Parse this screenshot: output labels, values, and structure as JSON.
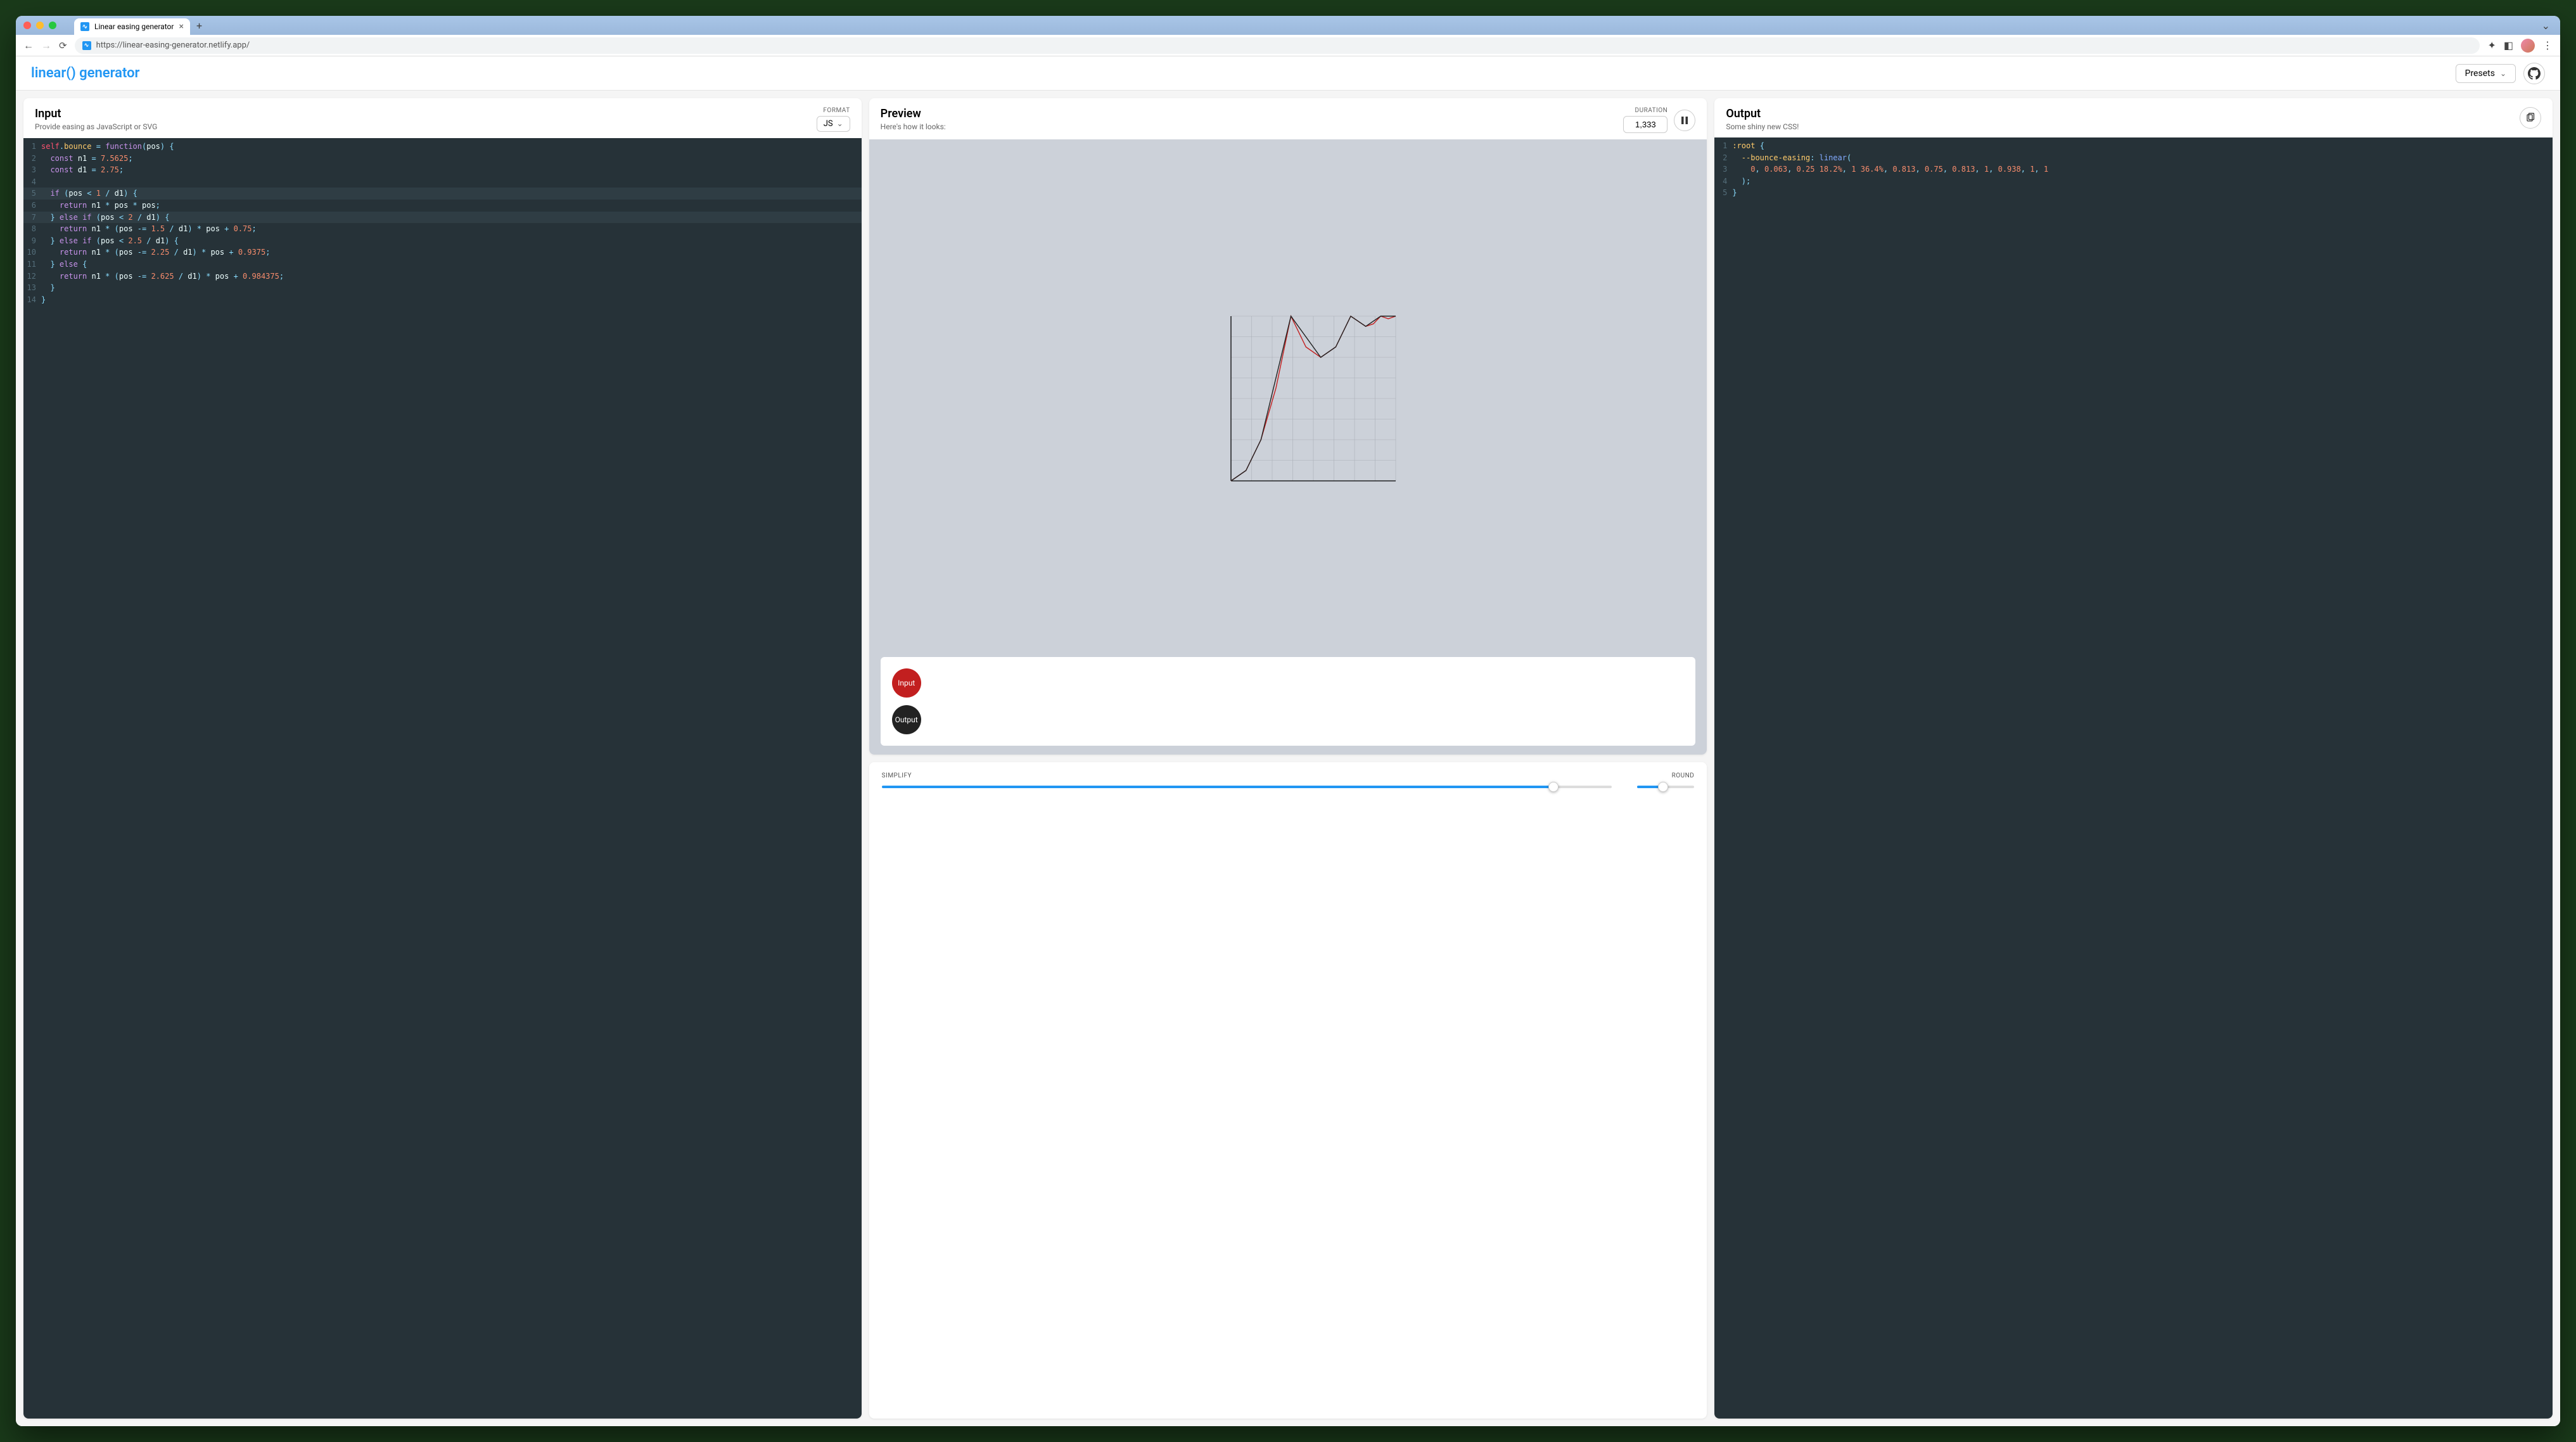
{
  "browser": {
    "tab_title": "Linear easing generator",
    "url": "https://linear-easing-generator.netlify.app/"
  },
  "header": {
    "app_title": "linear() generator",
    "presets_label": "Presets"
  },
  "input_panel": {
    "title": "Input",
    "subtitle": "Provide easing as JavaScript or SVG",
    "format_label": "FORMAT",
    "format_value": "JS",
    "code_lines": [
      {
        "n": 1,
        "hl": false,
        "tokens": [
          [
            "self",
            "self"
          ],
          [
            "op",
            "."
          ],
          [
            "prop",
            "bounce"
          ],
          [
            "var",
            " "
          ],
          [
            "op",
            "="
          ],
          [
            "var",
            " "
          ],
          [
            "kw",
            "function"
          ],
          [
            "pn",
            "("
          ],
          [
            "var",
            "pos"
          ],
          [
            "pn",
            ")"
          ],
          [
            "var",
            " "
          ],
          [
            "pn",
            "{"
          ]
        ]
      },
      {
        "n": 2,
        "hl": false,
        "tokens": [
          [
            "var",
            "  "
          ],
          [
            "kw",
            "const"
          ],
          [
            "var",
            " n1 "
          ],
          [
            "op",
            "="
          ],
          [
            "var",
            " "
          ],
          [
            "num",
            "7.5625"
          ],
          [
            "pn",
            ";"
          ]
        ]
      },
      {
        "n": 3,
        "hl": false,
        "tokens": [
          [
            "var",
            "  "
          ],
          [
            "kw",
            "const"
          ],
          [
            "var",
            " d1 "
          ],
          [
            "op",
            "="
          ],
          [
            "var",
            " "
          ],
          [
            "num",
            "2.75"
          ],
          [
            "pn",
            ";"
          ]
        ]
      },
      {
        "n": 4,
        "hl": false,
        "tokens": [
          [
            "var",
            ""
          ]
        ]
      },
      {
        "n": 5,
        "hl": true,
        "tokens": [
          [
            "var",
            "  "
          ],
          [
            "kw",
            "if"
          ],
          [
            "var",
            " "
          ],
          [
            "pn",
            "("
          ],
          [
            "var",
            "pos "
          ],
          [
            "op",
            "<"
          ],
          [
            "var",
            " "
          ],
          [
            "num",
            "1"
          ],
          [
            "var",
            " "
          ],
          [
            "op",
            "/"
          ],
          [
            "var",
            " d1"
          ],
          [
            "pn",
            ")"
          ],
          [
            "var",
            " "
          ],
          [
            "pn",
            "{"
          ]
        ]
      },
      {
        "n": 6,
        "hl": false,
        "tokens": [
          [
            "var",
            "    "
          ],
          [
            "kw",
            "return"
          ],
          [
            "var",
            " n1 "
          ],
          [
            "op",
            "*"
          ],
          [
            "var",
            " pos "
          ],
          [
            "op",
            "*"
          ],
          [
            "var",
            " pos"
          ],
          [
            "pn",
            ";"
          ]
        ]
      },
      {
        "n": 7,
        "hl": true,
        "tokens": [
          [
            "var",
            "  "
          ],
          [
            "pn",
            "}"
          ],
          [
            "var",
            " "
          ],
          [
            "kw",
            "else"
          ],
          [
            "var",
            " "
          ],
          [
            "kw",
            "if"
          ],
          [
            "var",
            " "
          ],
          [
            "pn",
            "("
          ],
          [
            "var",
            "pos "
          ],
          [
            "op",
            "<"
          ],
          [
            "var",
            " "
          ],
          [
            "num",
            "2"
          ],
          [
            "var",
            " "
          ],
          [
            "op",
            "/"
          ],
          [
            "var",
            " d1"
          ],
          [
            "pn",
            ")"
          ],
          [
            "var",
            " "
          ],
          [
            "pn",
            "{"
          ]
        ]
      },
      {
        "n": 8,
        "hl": false,
        "tokens": [
          [
            "var",
            "    "
          ],
          [
            "kw",
            "return"
          ],
          [
            "var",
            " n1 "
          ],
          [
            "op",
            "*"
          ],
          [
            "var",
            " "
          ],
          [
            "pn",
            "("
          ],
          [
            "var",
            "pos "
          ],
          [
            "op",
            "-="
          ],
          [
            "var",
            " "
          ],
          [
            "num",
            "1.5"
          ],
          [
            "var",
            " "
          ],
          [
            "op",
            "/"
          ],
          [
            "var",
            " d1"
          ],
          [
            "pn",
            ")"
          ],
          [
            "var",
            " "
          ],
          [
            "op",
            "*"
          ],
          [
            "var",
            " pos "
          ],
          [
            "op",
            "+"
          ],
          [
            "var",
            " "
          ],
          [
            "num",
            "0.75"
          ],
          [
            "pn",
            ";"
          ]
        ]
      },
      {
        "n": 9,
        "hl": false,
        "tokens": [
          [
            "var",
            "  "
          ],
          [
            "pn",
            "}"
          ],
          [
            "var",
            " "
          ],
          [
            "kw",
            "else"
          ],
          [
            "var",
            " "
          ],
          [
            "kw",
            "if"
          ],
          [
            "var",
            " "
          ],
          [
            "pn",
            "("
          ],
          [
            "var",
            "pos "
          ],
          [
            "op",
            "<"
          ],
          [
            "var",
            " "
          ],
          [
            "num",
            "2.5"
          ],
          [
            "var",
            " "
          ],
          [
            "op",
            "/"
          ],
          [
            "var",
            " d1"
          ],
          [
            "pn",
            ")"
          ],
          [
            "var",
            " "
          ],
          [
            "pn",
            "{"
          ]
        ]
      },
      {
        "n": 10,
        "hl": false,
        "tokens": [
          [
            "var",
            "    "
          ],
          [
            "kw",
            "return"
          ],
          [
            "var",
            " n1 "
          ],
          [
            "op",
            "*"
          ],
          [
            "var",
            " "
          ],
          [
            "pn",
            "("
          ],
          [
            "var",
            "pos "
          ],
          [
            "op",
            "-="
          ],
          [
            "var",
            " "
          ],
          [
            "num",
            "2.25"
          ],
          [
            "var",
            " "
          ],
          [
            "op",
            "/"
          ],
          [
            "var",
            " d1"
          ],
          [
            "pn",
            ")"
          ],
          [
            "var",
            " "
          ],
          [
            "op",
            "*"
          ],
          [
            "var",
            " pos "
          ],
          [
            "op",
            "+"
          ],
          [
            "var",
            " "
          ],
          [
            "num",
            "0.9375"
          ],
          [
            "pn",
            ";"
          ]
        ]
      },
      {
        "n": 11,
        "hl": false,
        "tokens": [
          [
            "var",
            "  "
          ],
          [
            "pn",
            "}"
          ],
          [
            "var",
            " "
          ],
          [
            "kw",
            "else"
          ],
          [
            "var",
            " "
          ],
          [
            "pn",
            "{"
          ]
        ]
      },
      {
        "n": 12,
        "hl": false,
        "tokens": [
          [
            "var",
            "    "
          ],
          [
            "kw",
            "return"
          ],
          [
            "var",
            " n1 "
          ],
          [
            "op",
            "*"
          ],
          [
            "var",
            " "
          ],
          [
            "pn",
            "("
          ],
          [
            "var",
            "pos "
          ],
          [
            "op",
            "-="
          ],
          [
            "var",
            " "
          ],
          [
            "num",
            "2.625"
          ],
          [
            "var",
            " "
          ],
          [
            "op",
            "/"
          ],
          [
            "var",
            " d1"
          ],
          [
            "pn",
            ")"
          ],
          [
            "var",
            " "
          ],
          [
            "op",
            "*"
          ],
          [
            "var",
            " pos "
          ],
          [
            "op",
            "+"
          ],
          [
            "var",
            " "
          ],
          [
            "num",
            "0.984375"
          ],
          [
            "pn",
            ";"
          ]
        ]
      },
      {
        "n": 13,
        "hl": false,
        "tokens": [
          [
            "var",
            "  "
          ],
          [
            "pn",
            "}"
          ]
        ]
      },
      {
        "n": 14,
        "hl": false,
        "tokens": [
          [
            "pn",
            "}"
          ]
        ]
      }
    ]
  },
  "preview_panel": {
    "title": "Preview",
    "subtitle": "Here's how it looks:",
    "duration_label": "DURATION",
    "duration_value": "1,333",
    "ball_input_label": "Input",
    "ball_output_label": "Output"
  },
  "controls": {
    "simplify_label": "SIMPLIFY",
    "simplify_pct": 92,
    "round_label": "ROUND",
    "round_pct": 45
  },
  "output_panel": {
    "title": "Output",
    "subtitle": "Some shiny new CSS!",
    "code_lines": [
      {
        "n": 1,
        "tokens": [
          [
            "sel",
            ":root"
          ],
          [
            "var",
            " "
          ],
          [
            "pn",
            "{"
          ]
        ]
      },
      {
        "n": 2,
        "tokens": [
          [
            "var",
            "  "
          ],
          [
            "prop",
            "--bounce-easing"
          ],
          [
            "pn",
            ":"
          ],
          [
            "var",
            " "
          ],
          [
            "fn",
            "linear"
          ],
          [
            "pn",
            "("
          ]
        ]
      },
      {
        "n": 3,
        "tokens": [
          [
            "var",
            "    "
          ],
          [
            "num",
            "0"
          ],
          [
            "pn",
            ","
          ],
          [
            "var",
            " "
          ],
          [
            "num",
            "0.063"
          ],
          [
            "pn",
            ","
          ],
          [
            "var",
            " "
          ],
          [
            "num",
            "0.25"
          ],
          [
            "var",
            " "
          ],
          [
            "num",
            "18.2%"
          ],
          [
            "pn",
            ","
          ],
          [
            "var",
            " "
          ],
          [
            "num",
            "1"
          ],
          [
            "var",
            " "
          ],
          [
            "num",
            "36.4%"
          ],
          [
            "pn",
            ","
          ],
          [
            "var",
            " "
          ],
          [
            "num",
            "0.813"
          ],
          [
            "pn",
            ","
          ],
          [
            "var",
            " "
          ],
          [
            "num",
            "0.75"
          ],
          [
            "pn",
            ","
          ],
          [
            "var",
            " "
          ],
          [
            "num",
            "0.813"
          ],
          [
            "pn",
            ","
          ],
          [
            "var",
            " "
          ],
          [
            "num",
            "1"
          ],
          [
            "pn",
            ","
          ],
          [
            "var",
            " "
          ],
          [
            "num",
            "0.938"
          ],
          [
            "pn",
            ","
          ],
          [
            "var",
            " "
          ],
          [
            "num",
            "1"
          ],
          [
            "pn",
            ","
          ],
          [
            "var",
            " "
          ],
          [
            "num",
            "1"
          ]
        ]
      },
      {
        "n": 4,
        "tokens": [
          [
            "var",
            "  "
          ],
          [
            "pn",
            ")"
          ],
          [
            "pn",
            ";"
          ]
        ]
      },
      {
        "n": 5,
        "tokens": [
          [
            "pn",
            "}"
          ]
        ]
      }
    ]
  },
  "chart_data": {
    "type": "line",
    "title": "",
    "xlabel": "",
    "ylabel": "",
    "xlim": [
      0,
      1
    ],
    "ylim": [
      0,
      1
    ],
    "grid": true,
    "series": [
      {
        "name": "input",
        "color": "#c21f1f",
        "x": [
          0,
          0.091,
          0.182,
          0.273,
          0.364,
          0.455,
          0.545,
          0.636,
          0.727,
          0.818,
          0.864,
          0.909,
          0.955,
          1
        ],
        "y": [
          0,
          0.063,
          0.25,
          0.563,
          1,
          0.813,
          0.75,
          0.813,
          1,
          0.938,
          0.953,
          1,
          0.984,
          1
        ]
      },
      {
        "name": "output",
        "color": "#222",
        "x": [
          0,
          0.091,
          0.182,
          0.364,
          0.545,
          0.636,
          0.727,
          0.818,
          0.909,
          1
        ],
        "y": [
          0,
          0.063,
          0.25,
          1,
          0.75,
          0.813,
          1,
          0.938,
          1,
          1
        ]
      }
    ]
  }
}
